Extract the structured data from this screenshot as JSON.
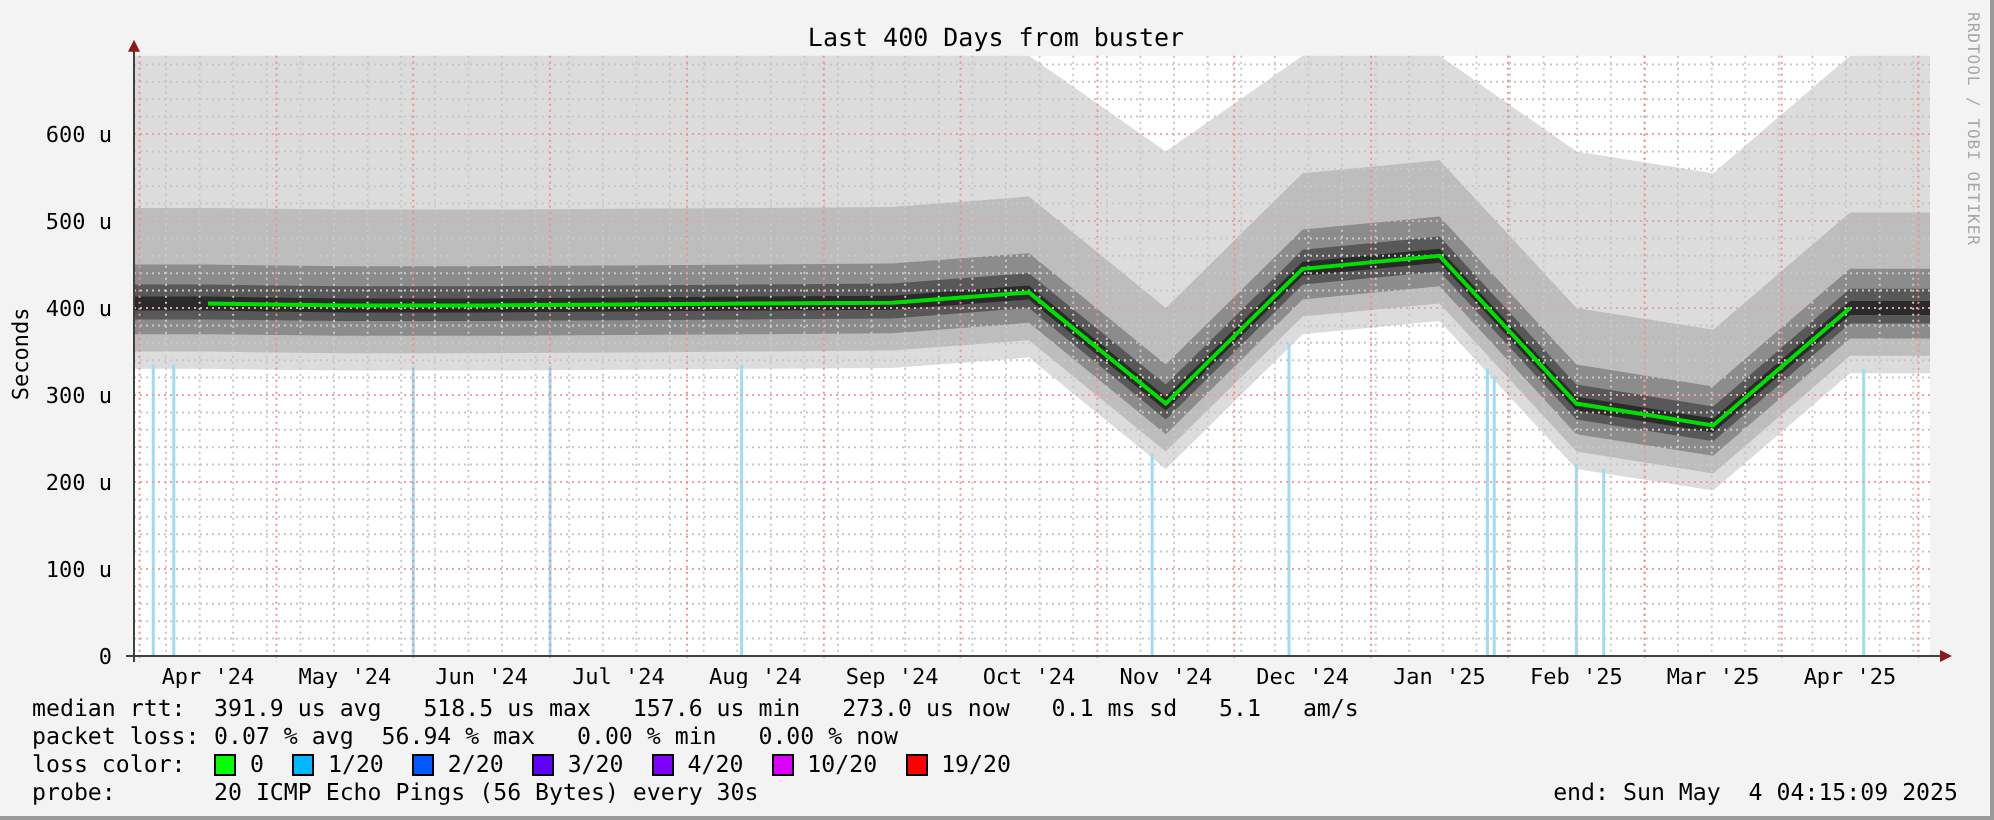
{
  "graph": {
    "credit": "RRDTOOL / TOBI OETIKER",
    "chart_data": {
      "type": "line",
      "title": "Last 400 Days from buster",
      "ylabel": "Seconds",
      "categories": [
        "Apr '24",
        "May '24",
        "Jun '24",
        "Jul '24",
        "Aug '24",
        "Sep '24",
        "Oct '24",
        "Nov '24",
        "Dec '24",
        "Jan '25",
        "Feb '25",
        "Mar '25",
        "Apr '25"
      ],
      "series": [
        {
          "name": "median rtt:",
          "color": "#00e000",
          "values": [
            405,
            403,
            403,
            404,
            405,
            406,
            418,
            290,
            445,
            460,
            290,
            265,
            400
          ]
        }
      ],
      "ylim": [
        0,
        690
      ],
      "grid": true,
      "yticks": [
        {
          "value": 0,
          "label": "0"
        },
        {
          "value": 100,
          "label": "100 u"
        },
        {
          "value": 200,
          "label": "200 u"
        },
        {
          "value": 300,
          "label": "300 u"
        },
        {
          "value": 400,
          "label": "400 u"
        },
        {
          "value": 500,
          "label": "500 u"
        },
        {
          "value": 600,
          "label": "600 u"
        }
      ]
    }
  },
  "legend": {
    "stats": [
      {
        "value": "391.9 us avg   518.5 us max   157.6 us min   273.0 us now   0.1 ms sd   5.1   am/s"
      },
      {
        "label": "packet loss:",
        "value": "0.07 % avg  56.94 % max   0.00 % min   0.00 % now"
      }
    ],
    "loss_color_label": "loss color:",
    "loss_colors": [
      {
        "label": "0",
        "color": "#00ff00"
      },
      {
        "label": "1/20",
        "color": "#00b8ff"
      },
      {
        "label": "2/20",
        "color": "#0059ff"
      },
      {
        "label": "3/20",
        "color": "#5e00ff"
      },
      {
        "label": "4/20",
        "color": "#7e00ff"
      },
      {
        "label": "10/20",
        "color": "#dd00ff"
      },
      {
        "label": "19/20",
        "color": "#ff0000"
      }
    ],
    "probe_label": "probe:",
    "probe": "20 ICMP Echo Pings (56 Bytes) every 30s",
    "end": "end: Sun May  4 04:15:09 2025"
  }
}
